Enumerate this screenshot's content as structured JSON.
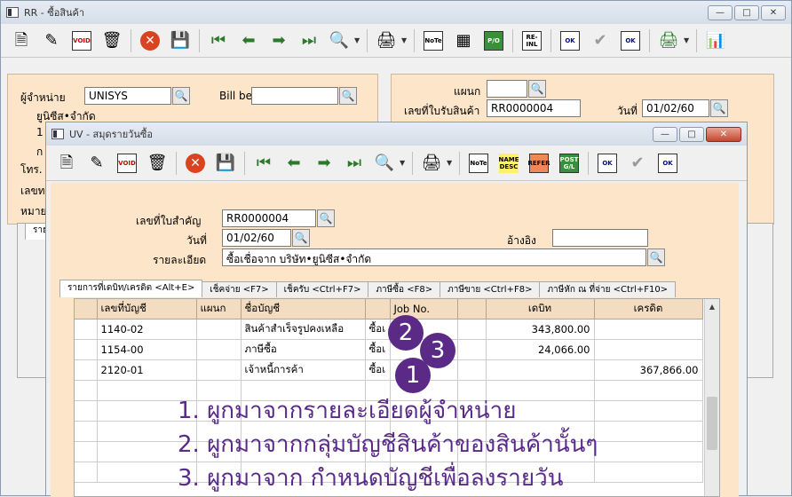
{
  "back_window": {
    "title": "RR - ซื้อสินค้า",
    "fields": {
      "vendor_label": "ผู้จำหน่าย",
      "vendor_value": "UNISYS",
      "vendor_name": "ยูนิซีส•จำกัด",
      "bill_label": "Bill be",
      "dept_label": "แผนก",
      "receipt_label": "เลขที่ใบรับสินค้า",
      "receipt_value": "RR0000004",
      "date_label": "วันที่",
      "date_value": "01/02/60",
      "phone_label": "โทร.",
      "number_label": "เลขท",
      "note_label": "หมาย",
      "row_label_1": "1",
      "row_label_2": "ก",
      "tab_label": "ราย"
    }
  },
  "front_window": {
    "title": "UV - สมุดรายวันซื้อ",
    "fields": {
      "doc_no_label": "เลขที่ใบสำคัญ",
      "doc_no_value": "RR0000004",
      "date_label": "วันที่",
      "date_value": "01/02/60",
      "ref_label": "อ้างอิง",
      "ref_value": "",
      "desc_label": "รายละเอียด",
      "desc_value": "ซื้อเชื่อจาก  บริษัท•ยูนิซีส•จำกัด"
    },
    "tabs": [
      {
        "label": "รายการที่เดบิท/เครดิต <Alt+E>",
        "active": true
      },
      {
        "label": "เช็คจ่าย <F7>",
        "active": false
      },
      {
        "label": "เช็ครับ <Ctrl+F7>",
        "active": false
      },
      {
        "label": "ภาษีซื้อ <F8>",
        "active": false
      },
      {
        "label": "ภาษีขาย <Ctrl+F8>",
        "active": false
      },
      {
        "label": "ภาษีหัก ณ ที่จ่าย <Ctrl+F10>",
        "active": false
      }
    ],
    "grid": {
      "headers": [
        "เลขที่บัญชี",
        "แผนก",
        "ชื่อบัญชี",
        "",
        "Job No.",
        "",
        "เดบิท",
        "เครดิต"
      ],
      "rows": [
        {
          "account": "1140-02",
          "dept": "",
          "name": "สินค้าสำเร็จรูปคงเหลือ",
          "extra": "ซื้อเ",
          "job": "",
          "debit": "343,800.00",
          "credit": ""
        },
        {
          "account": "1154-00",
          "dept": "",
          "name": "ภาษีซื้อ",
          "extra": "ซื้อเ",
          "job": "",
          "debit": "24,066.00",
          "credit": ""
        },
        {
          "account": "2120-01",
          "dept": "",
          "name": "เจ้าหนี้การค้า",
          "extra": "ซื้อเ",
          "job": "",
          "debit": "",
          "credit": "367,866.00"
        }
      ]
    }
  },
  "annotations": {
    "badges": [
      "2",
      "3",
      "1"
    ],
    "lines": [
      "1. ผูกมาจากรายละเอียดผู้จำหน่าย",
      "2. ผูกมาจากกลุ่มบัญชีสินค้าของสินค้านั้นๆ",
      "3. ผูกมาจาก กำหนดบัญชีเพื่อลงรายวัน"
    ]
  },
  "toolbar_labels": {
    "void": "VOID",
    "note": "NoTe",
    "po": "P/O",
    "resend": "RE-INL",
    "ok": "OK",
    "name_desc": "NAME DESC",
    "post": "POST G/L",
    "refer": "REFER"
  },
  "colors": {
    "accent": "#5b2a86",
    "panel": "#fce5c8"
  }
}
